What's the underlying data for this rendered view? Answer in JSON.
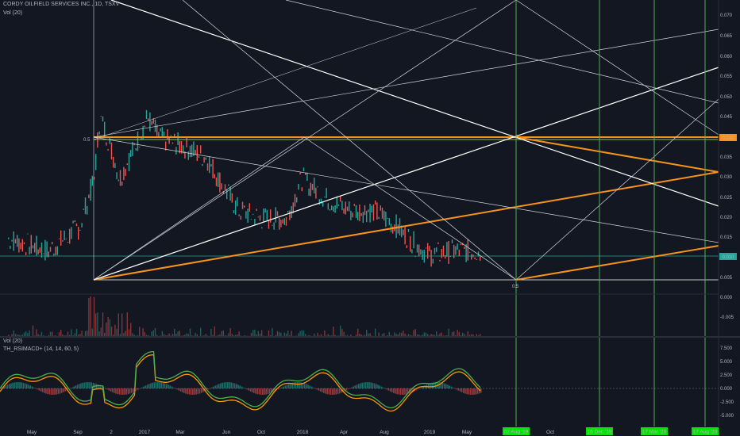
{
  "header": {
    "symbol_line": "CORDY OILFIELD SERVICES INC., 1D, TSXV",
    "vol_label": "Vol (20)",
    "sub_vol_label": "Vol (20)",
    "indicator_label": "TH_RSIMACD+ (14, 14, 60, 5)"
  },
  "price_axis": {
    "ticks": [
      "0.070",
      "0.065",
      "0.060",
      "0.055",
      "0.050",
      "0.045",
      "0.040",
      "0.035",
      "0.030",
      "0.025",
      "0.020",
      "0.015",
      "0.010",
      "0.005",
      "0.000",
      "-0.005"
    ],
    "current_price_badge": "0.040",
    "level_badge": "0.010"
  },
  "indicator_axis": {
    "ticks": [
      "7.500",
      "5.000",
      "2.500",
      "0.000",
      "-2.500",
      "-5.000"
    ]
  },
  "time_axis": {
    "labels": [
      "May",
      "Sep",
      "2",
      "2017",
      "Mar",
      "Jun",
      "Oct",
      "2018",
      "Apr",
      "Aug",
      "2019",
      "May",
      "Oct"
    ],
    "date_badges": [
      "02 Aug '19",
      "16 Dec '19",
      "17 Mar '20",
      "17 Aug '20"
    ]
  },
  "annotations": {
    "fib_left": "0.5",
    "fib_bottom": "0.5"
  },
  "colors": {
    "background": "#131722",
    "up": "#26a69a",
    "down": "#ef5350",
    "orange": "#f7931a",
    "green_line": "#4caf50",
    "white_line": "#ffffff",
    "badge_green": "#00e600"
  }
}
